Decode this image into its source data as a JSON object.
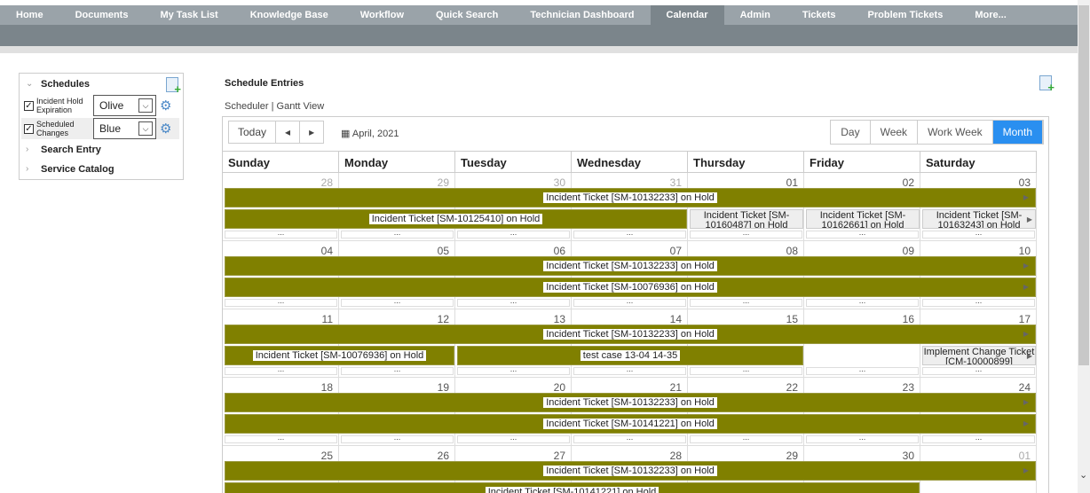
{
  "nav": [
    "Home",
    "Documents",
    "My Task List",
    "Knowledge Base",
    "Workflow",
    "Quick Search",
    "Technician Dashboard",
    "Calendar",
    "Admin",
    "Tickets",
    "Problem Tickets",
    "More..."
  ],
  "nav_active": "Calendar",
  "sidebar": {
    "schedules": "Schedules",
    "items": [
      {
        "label1": "Incident Hold",
        "label2": "Expiration",
        "color": "Olive",
        "checked": true
      },
      {
        "label1": "Scheduled",
        "label2": "Changes",
        "color": "Blue",
        "checked": true
      }
    ],
    "search_entry": "Search Entry",
    "service_catalog": "Service Catalog"
  },
  "main": {
    "title": "Schedule Entries",
    "view_scheduler": "Scheduler",
    "view_gantt": "Gantt View",
    "sep": "|"
  },
  "toolbar": {
    "today": "Today",
    "prev": "◂",
    "next": "▸",
    "date": "April, 2021",
    "views": [
      "Day",
      "Week",
      "Work Week",
      "Month"
    ],
    "active_view": "Month"
  },
  "days": [
    "Sunday",
    "Monday",
    "Tuesday",
    "Wednesday",
    "Thursday",
    "Friday",
    "Saturday"
  ],
  "colors": {
    "olive": "#808000",
    "active": "#2a8ff0"
  },
  "weeks": [
    {
      "dates": [
        "28",
        "29",
        "30",
        "31",
        "01",
        "02",
        "03"
      ],
      "other": [
        0,
        1,
        2,
        3
      ],
      "events": [
        {
          "row": 0,
          "start": 0,
          "end": 6,
          "text": "Incident Ticket [SM-10132233] on Hold",
          "type": "olive",
          "arrow": true
        },
        {
          "row": 1,
          "start": 0,
          "end": 3,
          "text": "Incident Ticket [SM-10125410] on Hold",
          "type": "olive"
        },
        {
          "row": 1,
          "start": 4,
          "end": 4,
          "text": "Incident Ticket [SM-10160487] on Hold",
          "type": "gray"
        },
        {
          "row": 1,
          "start": 5,
          "end": 5,
          "text": "Incident Ticket [SM-10162661] on Hold",
          "type": "gray"
        },
        {
          "row": 1,
          "start": 6,
          "end": 6,
          "text": "Incident Ticket [SM-10163243] on Hold",
          "type": "gray",
          "arrow": true
        }
      ]
    },
    {
      "dates": [
        "04",
        "05",
        "06",
        "07",
        "08",
        "09",
        "10"
      ],
      "other": [],
      "events": [
        {
          "row": 0,
          "start": 0,
          "end": 6,
          "text": "Incident Ticket [SM-10132233] on Hold",
          "type": "olive",
          "arrow": true
        },
        {
          "row": 1,
          "start": 0,
          "end": 6,
          "text": "Incident Ticket [SM-10076936] on Hold",
          "type": "olive",
          "arrow": true
        }
      ]
    },
    {
      "dates": [
        "11",
        "12",
        "13",
        "14",
        "15",
        "16",
        "17"
      ],
      "other": [],
      "events": [
        {
          "row": 0,
          "start": 0,
          "end": 6,
          "text": "Incident Ticket [SM-10132233] on Hold",
          "type": "olive",
          "arrow": true
        },
        {
          "row": 1,
          "start": 0,
          "end": 1,
          "text": "Incident Ticket [SM-10076936] on Hold",
          "type": "olive"
        },
        {
          "row": 1,
          "start": 2,
          "end": 4,
          "text": "test case 13-04 14-35",
          "type": "olive"
        },
        {
          "row": 1,
          "start": 6,
          "end": 6,
          "text": "Implement Change Ticket [CM-10000899]",
          "type": "gray",
          "arrow": true
        }
      ]
    },
    {
      "dates": [
        "18",
        "19",
        "20",
        "21",
        "22",
        "23",
        "24"
      ],
      "other": [],
      "events": [
        {
          "row": 0,
          "start": 0,
          "end": 6,
          "text": "Incident Ticket [SM-10132233] on Hold",
          "type": "olive",
          "arrow": true
        },
        {
          "row": 1,
          "start": 0,
          "end": 6,
          "text": "Incident Ticket [SM-10141221] on Hold",
          "type": "olive",
          "arrow": true
        }
      ]
    },
    {
      "dates": [
        "25",
        "26",
        "27",
        "28",
        "29",
        "30",
        "01"
      ],
      "other": [
        6
      ],
      "events": [
        {
          "row": 0,
          "start": 0,
          "end": 6,
          "text": "Incident Ticket [SM-10132233] on Hold",
          "type": "olive",
          "arrow": true
        },
        {
          "row": 1,
          "start": 0,
          "end": 5,
          "text": "Incident Ticket [SM-10141221] on Hold",
          "type": "olive"
        }
      ]
    }
  ],
  "more": "..."
}
